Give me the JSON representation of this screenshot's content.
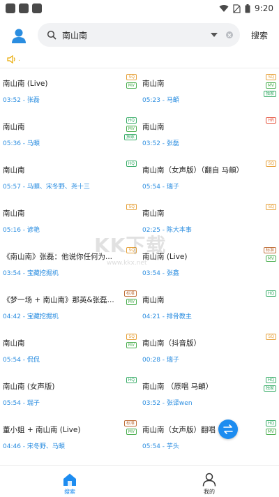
{
  "status_bar": {
    "time": "9:20",
    "icons": [
      "wifi-icon",
      "sim-icon",
      "battery-icon"
    ]
  },
  "search": {
    "query": "南山南",
    "button_label": "搜索"
  },
  "colors": {
    "accent": "#1d8cf0",
    "link": "#2a8de0"
  },
  "songs": [
    {
      "title": "南山南 (Live)",
      "duration": "03:52",
      "artist": "张磊",
      "badges": [
        "SQ",
        "MV"
      ]
    },
    {
      "title": "南山南",
      "duration": "05:23",
      "artist": "马頔",
      "badges": [
        "SQ",
        "MV",
        "独家"
      ]
    },
    {
      "title": "南山南",
      "duration": "05:36",
      "artist": "马頔",
      "badges": [
        "HQ",
        "MV",
        "独家"
      ]
    },
    {
      "title": "南山南",
      "duration": "03:52",
      "artist": "张磊",
      "badges": [
        "HR"
      ]
    },
    {
      "title": "南山南",
      "duration": "05:57",
      "artist": "马頔、宋冬野、尧十三",
      "badges": [
        "HQ"
      ]
    },
    {
      "title": "南山南（女声版）（翻自 马頔）",
      "duration": "05:54",
      "artist": "瑞子",
      "badges": [
        "SQ"
      ]
    },
    {
      "title": "南山南",
      "duration": "05:16",
      "artist": "谚艳",
      "badges": [
        "SQ"
      ]
    },
    {
      "title": "南山南",
      "duration": "02:25",
      "artist": "陈大本事",
      "badges": [
        "SQ"
      ]
    },
    {
      "title": "《南山南》张磊：他说你任何为...",
      "duration": "03:54",
      "artist": "宝藏挖掘机",
      "badges": [
        "SQ"
      ]
    },
    {
      "title": "南山南 (Live)",
      "duration": "03:54",
      "artist": "张鑫",
      "badges": [
        "标准",
        "MV"
      ]
    },
    {
      "title": "《梦一场 + 南山南》那英&张磊...",
      "duration": "04:42",
      "artist": "宝藏挖掘机",
      "badges": [
        "标准",
        "MV"
      ]
    },
    {
      "title": "南山南",
      "duration": "04:21",
      "artist": "排骨教主",
      "badges": [
        "HQ"
      ]
    },
    {
      "title": "南山南",
      "duration": "05:54",
      "artist": "侃侃",
      "badges": [
        "SQ",
        "MV"
      ]
    },
    {
      "title": "南山南（抖音版）",
      "duration": "00:28",
      "artist": "瑞子",
      "badges": [
        "SQ"
      ]
    },
    {
      "title": "南山南 (女声版)",
      "duration": "05:54",
      "artist": "瑞子",
      "badges": [
        "HQ"
      ]
    },
    {
      "title": "南山南 （原唱 马頔）",
      "duration": "03:52",
      "artist": "张译wen",
      "badges": [
        "HQ",
        "独家"
      ]
    },
    {
      "title": "董小姐 + 南山南 (Live)",
      "duration": "04:46",
      "artist": "宋冬野、马頔",
      "badges": [
        "标准",
        "MV"
      ]
    },
    {
      "title": "南山南（女声版）翻唱",
      "duration": "05:54",
      "artist": "芋头",
      "badges": [
        "HQ",
        "MV"
      ]
    }
  ],
  "watermark": {
    "main": "KK下载",
    "sub": "www.kkx.net"
  },
  "bottom_nav": [
    {
      "label": "搜索",
      "icon": "home-icon",
      "active": true
    },
    {
      "label": "我的",
      "icon": "person-icon",
      "active": false
    }
  ]
}
